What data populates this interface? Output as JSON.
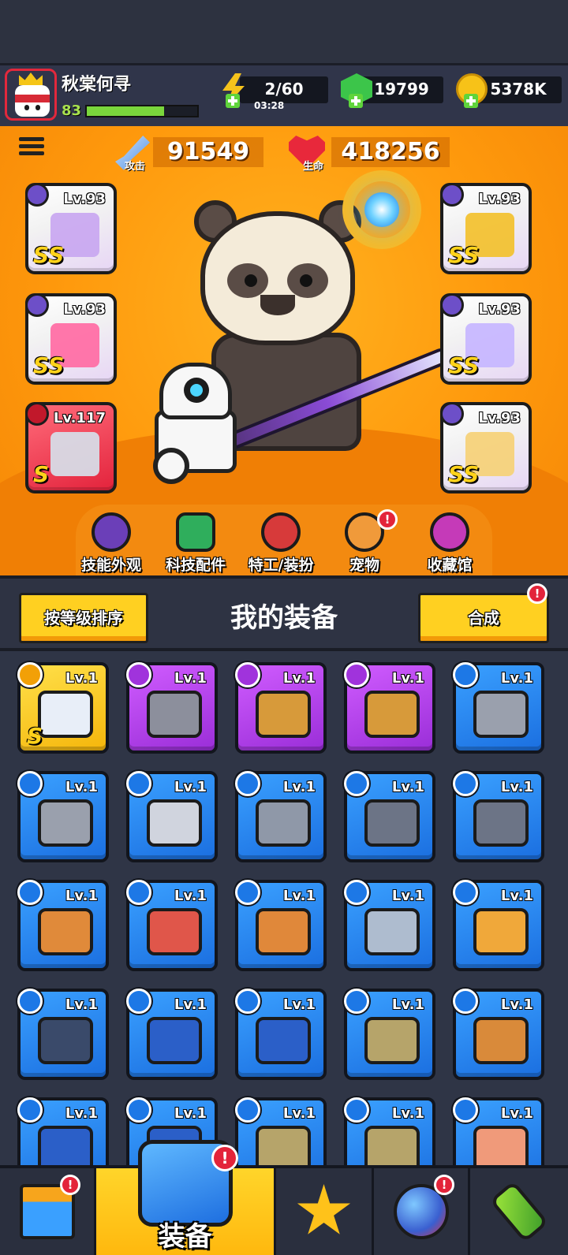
{
  "player": {
    "name": "秋棠何寻",
    "level": "83",
    "xp_fraction": 0.7
  },
  "resources": {
    "energy": {
      "value": "2/60",
      "timer": "03:28"
    },
    "gems": {
      "value": "19799"
    },
    "coins": {
      "value": "5378K"
    }
  },
  "stats": {
    "attack": {
      "label": "攻击",
      "value": "91549"
    },
    "health": {
      "label": "生命",
      "value": "418256"
    }
  },
  "equipped": [
    {
      "level": "Lv.93",
      "grade": "SS",
      "style": "white",
      "color": "#c9a9f0"
    },
    {
      "level": "Lv.93",
      "grade": "SS",
      "style": "white",
      "color": "#ff6fa5"
    },
    {
      "level": "Lv.117",
      "grade": "S",
      "style": "red",
      "color": "#d7dbe6"
    },
    {
      "level": "Lv.93",
      "grade": "SS",
      "style": "white",
      "color": "#f2c233"
    },
    {
      "level": "Lv.93",
      "grade": "SS",
      "style": "white",
      "color": "#c7b7ff"
    },
    {
      "level": "Lv.93",
      "grade": "SS",
      "style": "white",
      "color": "#f5d27a"
    }
  ],
  "categories": [
    {
      "label": "技能外观",
      "icon": "hat-icon",
      "badge": ""
    },
    {
      "label": "科技配件",
      "icon": "chip-icon",
      "badge": ""
    },
    {
      "label": "特工/装扮",
      "icon": "agent-icon",
      "badge": ""
    },
    {
      "label": "宠物",
      "icon": "pet-icon",
      "badge": "!"
    },
    {
      "label": "收藏馆",
      "icon": "chest-icon",
      "badge": ""
    }
  ],
  "equipment": {
    "title": "我的装备",
    "sort_label": "按等级排序",
    "merge_label": "合成",
    "merge_badge": "!"
  },
  "inventory": [
    {
      "level": "Lv.1",
      "rarity": "gold",
      "grade": "S",
      "color": "#e8eef8"
    },
    {
      "level": "Lv.1",
      "rarity": "purple",
      "grade": "",
      "color": "#8c8f9c"
    },
    {
      "level": "Lv.1",
      "rarity": "purple",
      "grade": "",
      "color": "#d79a3a"
    },
    {
      "level": "Lv.1",
      "rarity": "purple",
      "grade": "",
      "color": "#d79a3a"
    },
    {
      "level": "Lv.1",
      "rarity": "blue",
      "grade": "",
      "color": "#9aa0ad"
    },
    {
      "level": "Lv.1",
      "rarity": "blue",
      "grade": "",
      "color": "#9aa0ad"
    },
    {
      "level": "Lv.1",
      "rarity": "blue",
      "grade": "",
      "color": "#d0d4de"
    },
    {
      "level": "Lv.1",
      "rarity": "blue",
      "grade": "",
      "color": "#8f98a8"
    },
    {
      "level": "Lv.1",
      "rarity": "blue",
      "grade": "",
      "color": "#6c7486"
    },
    {
      "level": "Lv.1",
      "rarity": "blue",
      "grade": "",
      "color": "#6c7486"
    },
    {
      "level": "Lv.1",
      "rarity": "blue",
      "grade": "",
      "color": "#e08a3a"
    },
    {
      "level": "Lv.1",
      "rarity": "blue",
      "grade": "",
      "color": "#e0564a"
    },
    {
      "level": "Lv.1",
      "rarity": "blue",
      "grade": "",
      "color": "#e0883a"
    },
    {
      "level": "Lv.1",
      "rarity": "blue",
      "grade": "",
      "color": "#aebccf"
    },
    {
      "level": "Lv.1",
      "rarity": "blue",
      "grade": "",
      "color": "#f0a83a"
    },
    {
      "level": "Lv.1",
      "rarity": "blue",
      "grade": "",
      "color": "#3a4a6a"
    },
    {
      "level": "Lv.1",
      "rarity": "blue",
      "grade": "",
      "color": "#2b5fc8"
    },
    {
      "level": "Lv.1",
      "rarity": "blue",
      "grade": "",
      "color": "#2b5fc8"
    },
    {
      "level": "Lv.1",
      "rarity": "blue",
      "grade": "",
      "color": "#b6a46a"
    },
    {
      "level": "Lv.1",
      "rarity": "blue",
      "grade": "",
      "color": "#d98a3a"
    },
    {
      "level": "Lv.1",
      "rarity": "blue",
      "grade": "",
      "color": "#2b5fc8"
    },
    {
      "level": "Lv.1",
      "rarity": "blue",
      "grade": "",
      "color": "#2b5fc8"
    },
    {
      "level": "Lv.1",
      "rarity": "blue",
      "grade": "",
      "color": "#b6a46a"
    },
    {
      "level": "Lv.1",
      "rarity": "blue",
      "grade": "",
      "color": "#b6a46a"
    },
    {
      "level": "Lv.1",
      "rarity": "blue",
      "grade": "",
      "color": "#f09a7a"
    }
  ],
  "nav": {
    "shop_badge": "!",
    "equip_label": "装备",
    "equip_badge": "!",
    "ball_badge": "!"
  }
}
